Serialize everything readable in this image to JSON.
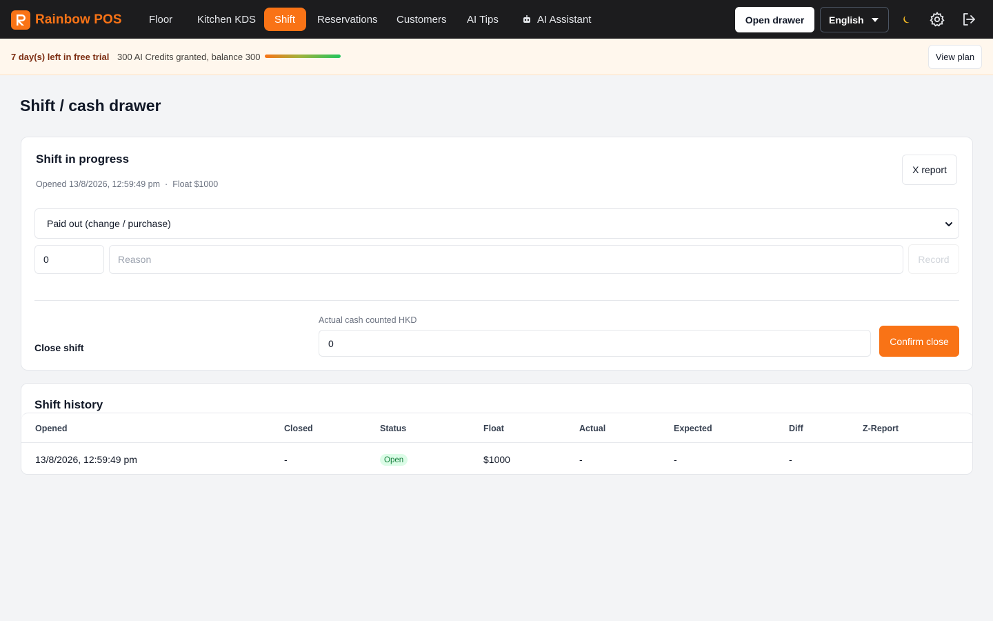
{
  "app": {
    "name": "Rainbow POS"
  },
  "nav": {
    "items": [
      {
        "label": "Floor"
      },
      {
        "label": "Kitchen KDS"
      },
      {
        "label": "Shift",
        "active": true
      },
      {
        "label": "Reservations"
      },
      {
        "label": "Customers"
      },
      {
        "label": "AI Tips"
      },
      {
        "label": "AI Assistant",
        "icon": "robot-icon"
      }
    ],
    "open_drawer": "Open drawer",
    "language": "English",
    "icons": [
      "moon-icon",
      "gear-icon",
      "logout-icon"
    ]
  },
  "trial": {
    "days_left": "7 day(s) left in free trial",
    "credits": "300 AI Credits granted, balance 300",
    "credits_fraction": 1.0,
    "view_plan": "View plan"
  },
  "page": {
    "title": "Shift / cash drawer"
  },
  "shift": {
    "title": "Shift in progress",
    "opened": "Opened 13/8/2026, 12:59:49 pm",
    "separator": "·",
    "float": "Float $1000",
    "x_report": "X report",
    "movement_type": "Paid out (change / purchase)",
    "amount_value": "0",
    "reason_placeholder": "Reason",
    "record": "Record",
    "close_label": "Close shift",
    "cash_label": "Actual cash counted HKD",
    "cash_value": "0",
    "confirm_close": "Confirm close"
  },
  "history": {
    "title": "Shift history",
    "columns": [
      "Opened",
      "Closed",
      "Status",
      "Float",
      "Actual",
      "Expected",
      "Diff",
      "Z-Report"
    ],
    "rows": [
      {
        "opened": "13/8/2026, 12:59:49 pm",
        "closed": "-",
        "status": "Open",
        "float": "$1000",
        "actual": "-",
        "expected": "-",
        "diff": "-",
        "zreport": ""
      }
    ]
  },
  "colors": {
    "accent": "#f97316",
    "topbar": "#1c1c1e",
    "banner": "#fff7ed",
    "status_open_bg": "#dcfce7",
    "status_open_text": "#15803d"
  }
}
